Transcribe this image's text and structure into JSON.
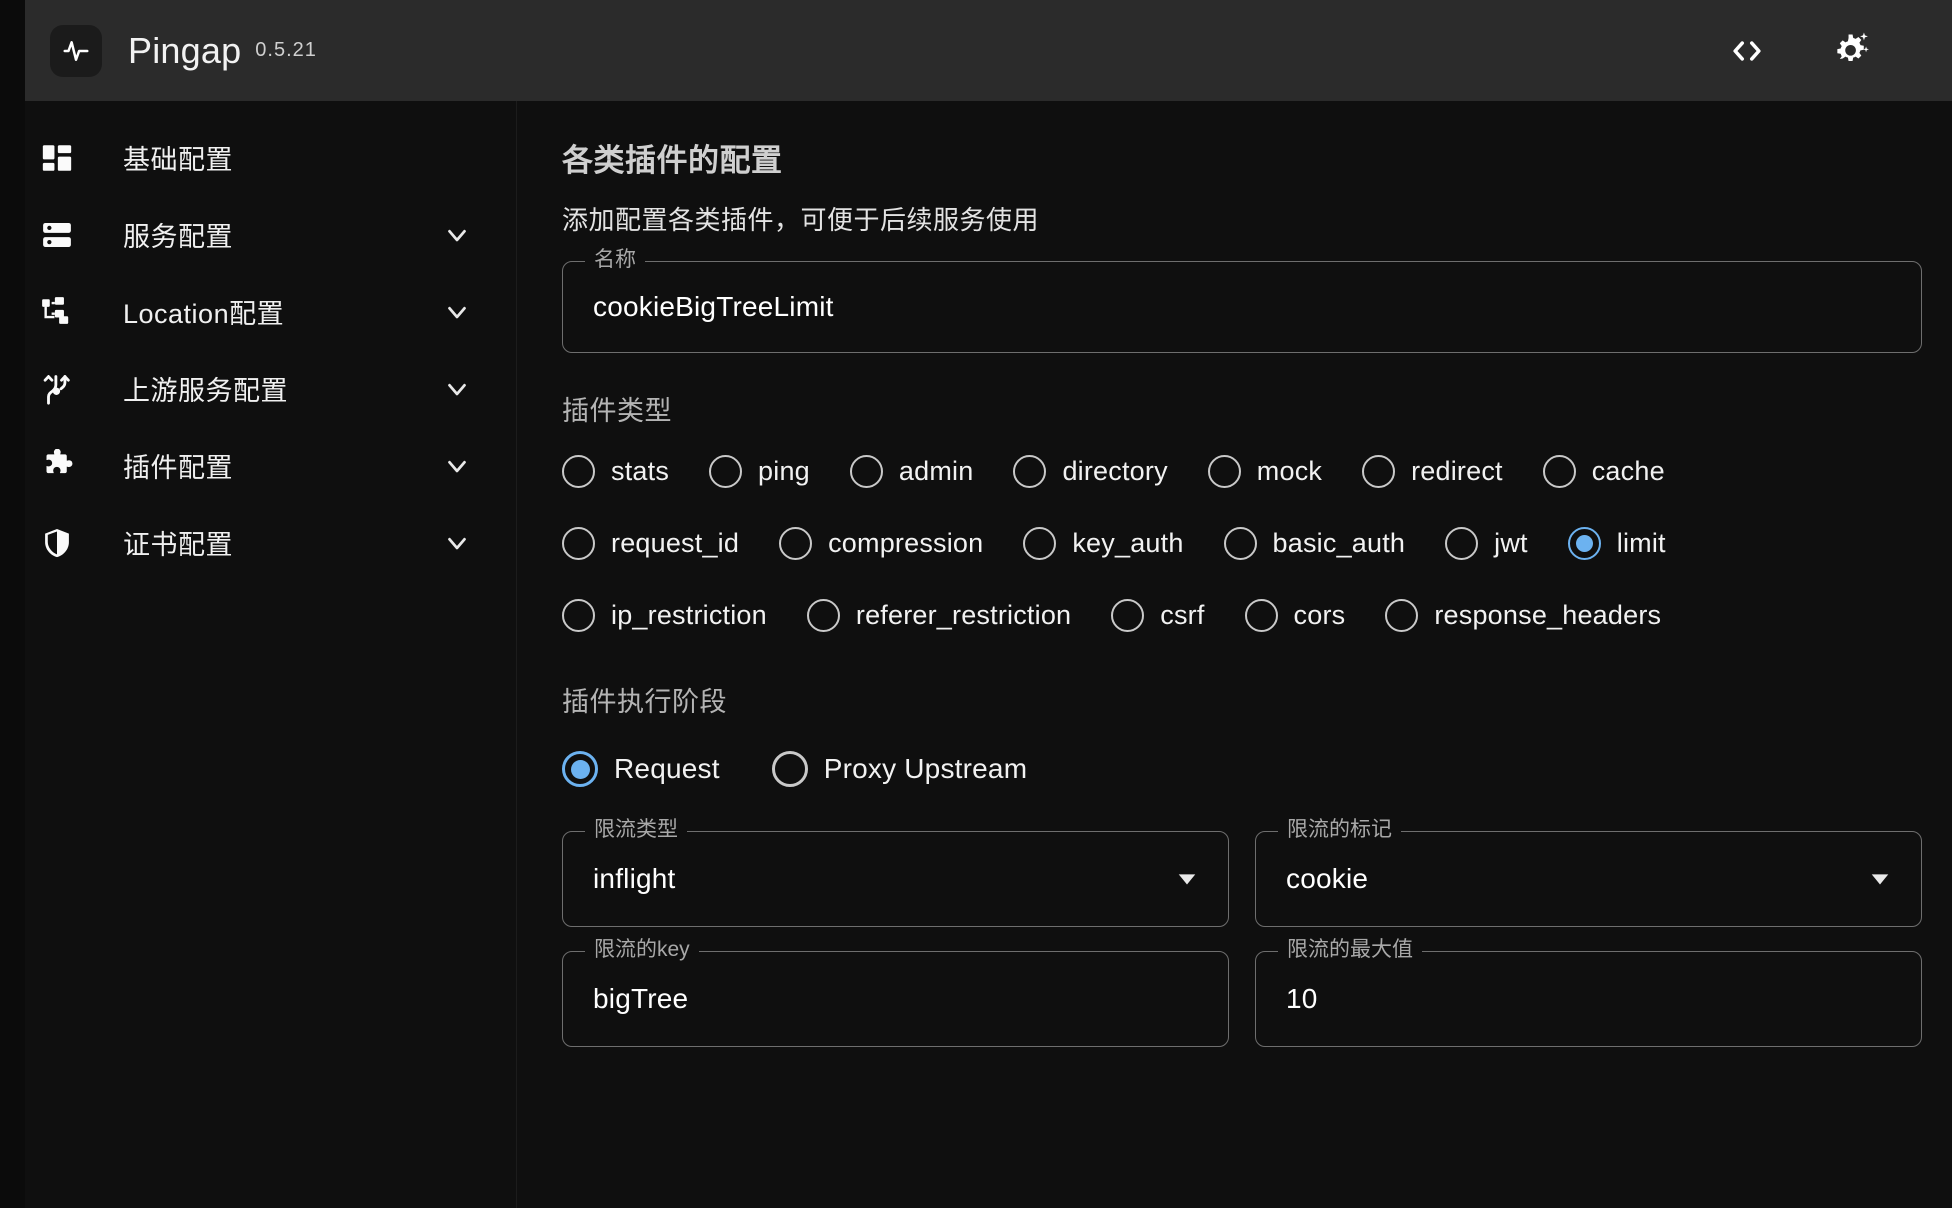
{
  "header": {
    "logo_icon": "pulse-icon",
    "title": "Pingap",
    "version": "0.5.21",
    "actions": [
      {
        "name": "code-icon",
        "label": "<>"
      },
      {
        "name": "gear-sparkle-icon",
        "label": "settings"
      }
    ]
  },
  "sidebar": {
    "items": [
      {
        "label": "基础配置",
        "icon": "dashboard-icon",
        "expandable": false
      },
      {
        "label": "服务配置",
        "icon": "server-icon",
        "expandable": true
      },
      {
        "label": "Location配置",
        "icon": "sitemap-icon",
        "expandable": true
      },
      {
        "label": "上游服务配置",
        "icon": "branch-icon",
        "expandable": true
      },
      {
        "label": "插件配置",
        "icon": "puzzle-icon",
        "expandable": true
      },
      {
        "label": "证书配置",
        "icon": "shield-icon",
        "expandable": true
      }
    ]
  },
  "main": {
    "title": "各类插件的配置",
    "subtitle": "添加配置各类插件，可便于后续服务使用",
    "name_field": {
      "label": "名称",
      "value": "cookieBigTreeLimit"
    },
    "plugin_type": {
      "label": "插件类型",
      "selected": "limit",
      "rows": [
        [
          "stats",
          "ping",
          "admin",
          "directory",
          "mock",
          "redirect",
          "cache"
        ],
        [
          "request_id",
          "compression",
          "key_auth",
          "basic_auth",
          "jwt",
          "limit"
        ],
        [
          "ip_restriction",
          "referer_restriction",
          "csrf",
          "cors",
          "response_headers"
        ]
      ]
    },
    "plugin_stage": {
      "label": "插件执行阶段",
      "selected": "Request",
      "options": [
        "Request",
        "Proxy Upstream"
      ]
    },
    "limit_fields": [
      {
        "label": "限流类型",
        "value": "inflight",
        "type": "select"
      },
      {
        "label": "限流的标记",
        "value": "cookie",
        "type": "select"
      },
      {
        "label": "限流的key",
        "value": "bigTree",
        "type": "text"
      },
      {
        "label": "限流的最大值",
        "value": "10",
        "type": "text"
      }
    ]
  },
  "colors": {
    "accent": "#6cb2f0",
    "header_bg": "#2b2b2b",
    "body_bg": "#0f0f0f",
    "border": "#6e6e6e"
  }
}
